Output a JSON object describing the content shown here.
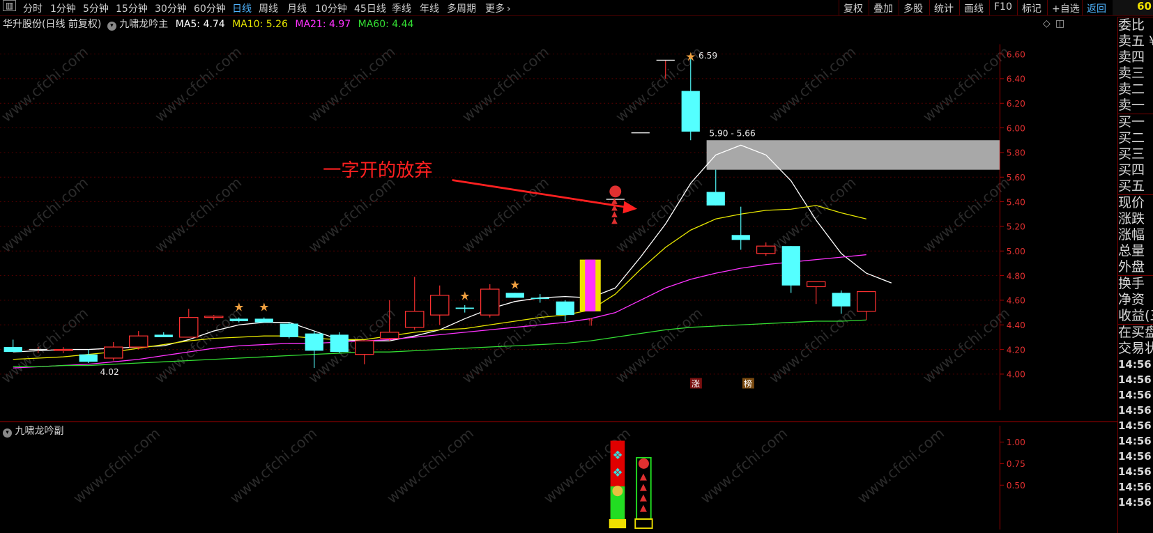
{
  "toolbar": {
    "menu_icon": "▥",
    "periods": [
      "分时",
      "1分钟",
      "5分钟",
      "15分钟",
      "30分钟",
      "60分钟",
      "日线",
      "周线",
      "月线",
      "10分钟",
      "45日线",
      "季线",
      "年线",
      "多周期",
      "更多"
    ],
    "active_period": "日线",
    "more_icon": "chevron-right-icon",
    "right_buttons": [
      "复权",
      "叠加",
      "多股",
      "统计",
      "画线",
      "F10",
      "标记",
      "+自选",
      "返回"
    ],
    "corner_value": "60"
  },
  "title_row": {
    "stock": "华升股份(日线 前复权)",
    "indicator": "九啸龙吟主",
    "ma5": "MA5: 4.74",
    "ma10": "MA10: 5.26",
    "ma21": "MA21: 4.97",
    "ma60": "MA60: 4.44",
    "colors": {
      "ma5": "#ffffff",
      "ma10": "#e6e600",
      "ma21": "#ff33ff",
      "ma60": "#33dd33"
    }
  },
  "annotation": {
    "text": "一字开的放弃",
    "color": "#ff2020"
  },
  "price_labels": {
    "high": "6.59",
    "low": "4.02",
    "zone": "5.90 - 5.66",
    "tag_zhang": "涨",
    "tag_bang": "榜"
  },
  "main_axis": [
    "6.60",
    "6.40",
    "6.20",
    "6.00",
    "5.80",
    "5.60",
    "5.40",
    "5.20",
    "5.00",
    "4.80",
    "4.60",
    "4.40",
    "4.20",
    "4.00"
  ],
  "sub_indicator": {
    "name": "九啸龙吟副",
    "axis": [
      "1.00",
      "0.75",
      "0.50"
    ]
  },
  "watermark": "www.cfchi.com",
  "right_panel": {
    "items": [
      "委比",
      "卖五 ¥",
      "卖四",
      "卖三",
      "卖二",
      "卖一",
      "买一",
      "买二",
      "买三",
      "买四",
      "买五",
      "现价",
      "涨跌",
      "涨幅",
      "总量",
      "外盘",
      "换手",
      "净资",
      "收益(三",
      "在买盘",
      "交易状"
    ],
    "times": [
      "14:56",
      "14:56",
      "14:56",
      "14:56",
      "14:56",
      "14:56",
      "14:56",
      "14:56",
      "14:56",
      "14:56"
    ]
  },
  "chart_data": {
    "type": "candlestick",
    "title": "华升股份(日线 前复权)",
    "ylim": [
      4.0,
      6.6
    ],
    "candles": [
      {
        "o": 4.22,
        "h": 4.28,
        "l": 4.18,
        "c": 4.18
      },
      {
        "o": 4.2,
        "h": 4.22,
        "l": 4.17,
        "c": 4.2
      },
      {
        "o": 4.19,
        "h": 4.22,
        "l": 4.17,
        "c": 4.2
      },
      {
        "o": 4.16,
        "h": 4.2,
        "l": 4.09,
        "c": 4.1
      },
      {
        "o": 4.13,
        "h": 4.26,
        "l": 4.11,
        "c": 4.22
      },
      {
        "o": 4.22,
        "h": 4.35,
        "l": 4.2,
        "c": 4.31
      },
      {
        "o": 4.32,
        "h": 4.34,
        "l": 4.31,
        "c": 4.3
      },
      {
        "o": 4.3,
        "h": 4.53,
        "l": 4.3,
        "c": 4.46
      },
      {
        "o": 4.46,
        "h": 4.48,
        "l": 4.44,
        "c": 4.47
      },
      {
        "o": 4.45,
        "h": 4.46,
        "l": 4.42,
        "c": 4.43
      },
      {
        "o": 4.45,
        "h": 4.46,
        "l": 4.42,
        "c": 4.42
      },
      {
        "o": 4.41,
        "h": 4.42,
        "l": 4.29,
        "c": 4.3
      },
      {
        "o": 4.33,
        "h": 4.35,
        "l": 4.05,
        "c": 4.19
      },
      {
        "o": 4.32,
        "h": 4.34,
        "l": 4.17,
        "c": 4.18
      },
      {
        "o": 4.16,
        "h": 4.27,
        "l": 4.08,
        "c": 4.27
      },
      {
        "o": 4.29,
        "h": 4.6,
        "l": 4.27,
        "c": 4.34
      },
      {
        "o": 4.38,
        "h": 4.79,
        "l": 4.36,
        "c": 4.51
      },
      {
        "o": 4.48,
        "h": 4.72,
        "l": 4.4,
        "c": 4.64
      },
      {
        "o": 4.54,
        "h": 4.56,
        "l": 4.5,
        "c": 4.53
      },
      {
        "o": 4.48,
        "h": 4.73,
        "l": 4.46,
        "c": 4.69
      },
      {
        "o": 4.66,
        "h": 4.66,
        "l": 4.62,
        "c": 4.62
      },
      {
        "o": 4.62,
        "h": 4.65,
        "l": 4.58,
        "c": 4.61
      },
      {
        "o": 4.59,
        "h": 4.6,
        "l": 4.43,
        "c": 4.48
      },
      {
        "o": 4.51,
        "h": 4.93,
        "l": 4.51,
        "c": 4.93
      },
      {
        "o": 5.42,
        "h": 5.42,
        "l": 5.42,
        "c": 5.42
      },
      {
        "o": 5.96,
        "h": 5.96,
        "l": 5.96,
        "c": 5.96
      },
      {
        "o": 6.55,
        "h": 6.55,
        "l": 6.4,
        "c": 6.55
      },
      {
        "o": 6.3,
        "h": 6.59,
        "l": 5.9,
        "c": 5.97
      },
      {
        "o": 5.48,
        "h": 5.66,
        "l": 5.37,
        "c": 5.37
      },
      {
        "o": 5.13,
        "h": 5.36,
        "l": 5.01,
        "c": 5.09
      },
      {
        "o": 4.98,
        "h": 5.07,
        "l": 4.96,
        "c": 5.04
      },
      {
        "o": 5.04,
        "h": 5.04,
        "l": 4.66,
        "c": 4.72
      },
      {
        "o": 4.71,
        "h": 4.75,
        "l": 4.57,
        "c": 4.75
      },
      {
        "o": 4.66,
        "h": 4.68,
        "l": 4.49,
        "c": 4.55
      },
      {
        "o": 4.51,
        "h": 4.67,
        "l": 4.44,
        "c": 4.67
      }
    ],
    "series": [
      {
        "name": "MA5",
        "color": "#ffffff",
        "values": [
          4.18,
          4.19,
          4.2,
          4.2,
          4.21,
          4.22,
          4.23,
          4.28,
          4.35,
          4.4,
          4.42,
          4.42,
          4.35,
          4.28,
          4.27,
          4.27,
          4.31,
          4.36,
          4.45,
          4.53,
          4.59,
          4.62,
          4.63,
          4.62,
          4.7,
          4.95,
          5.22,
          5.55,
          5.78,
          5.86,
          5.78,
          5.57,
          5.25,
          4.98,
          4.82,
          4.74
        ]
      },
      {
        "name": "MA10",
        "color": "#e6e600",
        "values": [
          4.12,
          4.13,
          4.14,
          4.16,
          4.18,
          4.21,
          4.24,
          4.27,
          4.29,
          4.3,
          4.31,
          4.31,
          4.29,
          4.28,
          4.28,
          4.31,
          4.34,
          4.36,
          4.37,
          4.4,
          4.43,
          4.46,
          4.48,
          4.52,
          4.65,
          4.85,
          5.03,
          5.17,
          5.26,
          5.3,
          5.33,
          5.34,
          5.37,
          5.31,
          5.26
        ]
      },
      {
        "name": "MA21",
        "color": "#ff33ff",
        "values": [
          4.05,
          4.06,
          4.07,
          4.08,
          4.1,
          4.12,
          4.15,
          4.18,
          4.21,
          4.23,
          4.24,
          4.25,
          4.25,
          4.26,
          4.27,
          4.28,
          4.3,
          4.32,
          4.34,
          4.36,
          4.38,
          4.4,
          4.42,
          4.45,
          4.5,
          4.6,
          4.7,
          4.77,
          4.82,
          4.86,
          4.89,
          4.91,
          4.93,
          4.95,
          4.97
        ]
      },
      {
        "name": "MA60",
        "color": "#33dd33",
        "values": [
          4.06,
          4.06,
          4.07,
          4.07,
          4.08,
          4.09,
          4.1,
          4.11,
          4.12,
          4.13,
          4.14,
          4.15,
          4.16,
          4.17,
          4.18,
          4.18,
          4.19,
          4.2,
          4.21,
          4.22,
          4.23,
          4.24,
          4.25,
          4.27,
          4.3,
          4.33,
          4.36,
          4.38,
          4.39,
          4.4,
          4.41,
          4.42,
          4.43,
          4.43,
          4.44
        ]
      }
    ],
    "resistance_zone": [
      5.66,
      5.9
    ]
  }
}
